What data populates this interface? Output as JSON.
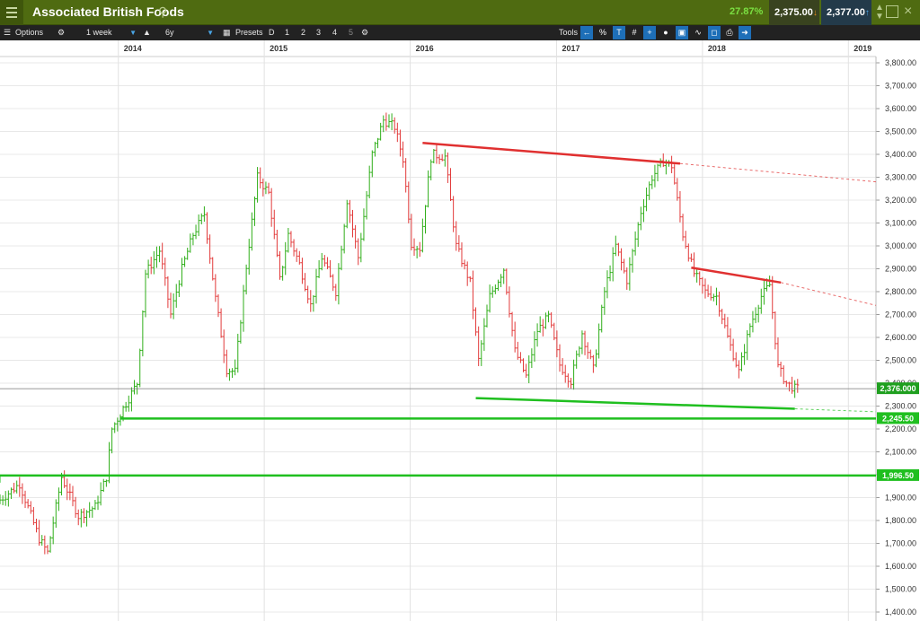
{
  "window": {
    "title": "Associated British Foods",
    "change_pct": "27.87%",
    "bid": "2,375.00",
    "ask": "2,377.00",
    "colors": {
      "titlebar": "#4f6b11",
      "up": "#7be042",
      "bid_bg": "#39431f",
      "ask_bg": "#233a4a"
    }
  },
  "toolbar": {
    "options_label": "Options",
    "period": "1 week",
    "range": "6y",
    "presets_label": "Presets",
    "presets": [
      "D",
      "1",
      "2",
      "3",
      "4",
      "5"
    ],
    "tools_label": "Tools"
  },
  "chart_data": {
    "type": "ohlc",
    "instrument": "Associated British Foods",
    "interval": "1 week",
    "x_axis": {
      "type": "date",
      "years": [
        "2014",
        "2015",
        "2016",
        "2017",
        "2018",
        "2019"
      ],
      "start": "2013-03-11",
      "end": "2019-03-11"
    },
    "y_axis": {
      "position": "right",
      "min": 1400,
      "max": 3800,
      "tick_step": 100,
      "tick_labels": [
        "3,800.00",
        "3,700.00",
        "3,600.00",
        "3,500.00",
        "3,400.00",
        "3,300.00",
        "3,200.00",
        "3,100.00",
        "3,000.00",
        "2,900.00",
        "2,800.00",
        "2,700.00",
        "2,600.00",
        "2,500.00",
        "2,400.00",
        "2,300.00",
        "2,200.00",
        "2,100.00",
        "2,000.00",
        "1,900.00",
        "1,800.00",
        "1,700.00",
        "1,600.00",
        "1,500.00",
        "1,400.00"
      ]
    },
    "grid": true,
    "colors": {
      "up": "#2fae19",
      "down": "#e23a3a",
      "support": "#1fbf1f",
      "resistance": "#e03030"
    },
    "price_path": [
      [
        "2013-03-11",
        1880
      ],
      [
        "2013-05-06",
        1960
      ],
      [
        "2013-06-24",
        1720
      ],
      [
        "2013-07-15",
        1660
      ],
      [
        "2013-08-19",
        1990
      ],
      [
        "2013-09-30",
        1820
      ],
      [
        "2013-11-11",
        1860
      ],
      [
        "2013-12-09",
        1990
      ],
      [
        "2013-12-23",
        2200
      ],
      [
        "2014-01-20",
        2290
      ],
      [
        "2014-02-24",
        2400
      ],
      [
        "2014-03-17",
        2880
      ],
      [
        "2014-04-21",
        2980
      ],
      [
        "2014-05-19",
        2700
      ],
      [
        "2014-06-16",
        2900
      ],
      [
        "2014-07-14",
        3050
      ],
      [
        "2014-08-11",
        3140
      ],
      [
        "2014-09-08",
        2770
      ],
      [
        "2014-10-06",
        2460
      ],
      [
        "2014-10-27",
        2450
      ],
      [
        "2014-11-24",
        2910
      ],
      [
        "2014-12-22",
        3300
      ],
      [
        "2015-01-19",
        3230
      ],
      [
        "2015-02-16",
        2850
      ],
      [
        "2015-03-09",
        3050
      ],
      [
        "2015-04-06",
        2920
      ],
      [
        "2015-05-04",
        2740
      ],
      [
        "2015-06-01",
        2950
      ],
      [
        "2015-07-06",
        2800
      ],
      [
        "2015-08-03",
        3200
      ],
      [
        "2015-08-31",
        2950
      ],
      [
        "2015-10-05",
        3400
      ],
      [
        "2015-11-02",
        3550
      ],
      [
        "2015-11-30",
        3520
      ],
      [
        "2015-12-21",
        3380
      ],
      [
        "2016-01-11",
        3010
      ],
      [
        "2016-02-01",
        2990
      ],
      [
        "2016-03-01",
        3400
      ],
      [
        "2016-04-04",
        3390
      ],
      [
        "2016-05-02",
        3000
      ],
      [
        "2016-06-06",
        2840
      ],
      [
        "2016-06-27",
        2500
      ],
      [
        "2016-07-25",
        2780
      ],
      [
        "2016-08-29",
        2900
      ],
      [
        "2016-09-26",
        2540
      ],
      [
        "2016-10-24",
        2430
      ],
      [
        "2016-11-21",
        2630
      ],
      [
        "2016-12-19",
        2690
      ],
      [
        "2017-01-16",
        2480
      ],
      [
        "2017-02-13",
        2410
      ],
      [
        "2017-03-13",
        2620
      ],
      [
        "2017-04-10",
        2460
      ],
      [
        "2017-05-08",
        2800
      ],
      [
        "2017-06-05",
        3000
      ],
      [
        "2017-07-03",
        2850
      ],
      [
        "2017-08-07",
        3150
      ],
      [
        "2017-09-04",
        3300
      ],
      [
        "2017-10-02",
        3370
      ],
      [
        "2017-10-23",
        3350
      ],
      [
        "2017-11-20",
        3050
      ],
      [
        "2017-12-18",
        2880
      ],
      [
        "2018-01-15",
        2800
      ],
      [
        "2018-02-12",
        2780
      ],
      [
        "2018-03-12",
        2600
      ],
      [
        "2018-04-09",
        2450
      ],
      [
        "2018-05-07",
        2650
      ],
      [
        "2018-06-04",
        2780
      ],
      [
        "2018-06-25",
        2830
      ],
      [
        "2018-07-16",
        2470
      ],
      [
        "2018-08-06",
        2400
      ],
      [
        "2018-08-27",
        2376
      ]
    ],
    "trendlines": [
      {
        "role": "resistance",
        "style": "solid",
        "points": [
          [
            "2016-02-01",
            3450
          ],
          [
            "2017-11-06",
            3360
          ]
        ],
        "extend": [
          [
            "2017-11-06",
            3360
          ],
          [
            "2019-03-11",
            3280
          ]
        ]
      },
      {
        "role": "resistance",
        "style": "solid",
        "points": [
          [
            "2017-12-04",
            2905
          ],
          [
            "2018-07-16",
            2840
          ]
        ],
        "extend": [
          [
            "2018-07-16",
            2840
          ],
          [
            "2019-03-11",
            2740
          ]
        ]
      },
      {
        "role": "support",
        "style": "solid",
        "points": [
          [
            "2016-06-13",
            2335
          ],
          [
            "2018-08-20",
            2288
          ]
        ],
        "extend": [
          [
            "2018-08-20",
            2288
          ],
          [
            "2019-03-11",
            2275
          ]
        ]
      }
    ],
    "horizontal_levels": [
      {
        "value": 2245.5,
        "label": "2,245.50",
        "color": "#1fbf1f",
        "start": "2014-01-06"
      },
      {
        "value": 1996.5,
        "label": "1,996.50",
        "color": "#1fbf1f",
        "start": "2013-03-11"
      }
    ],
    "last_price": {
      "value": 2376.0,
      "label": "2,376.000"
    }
  }
}
